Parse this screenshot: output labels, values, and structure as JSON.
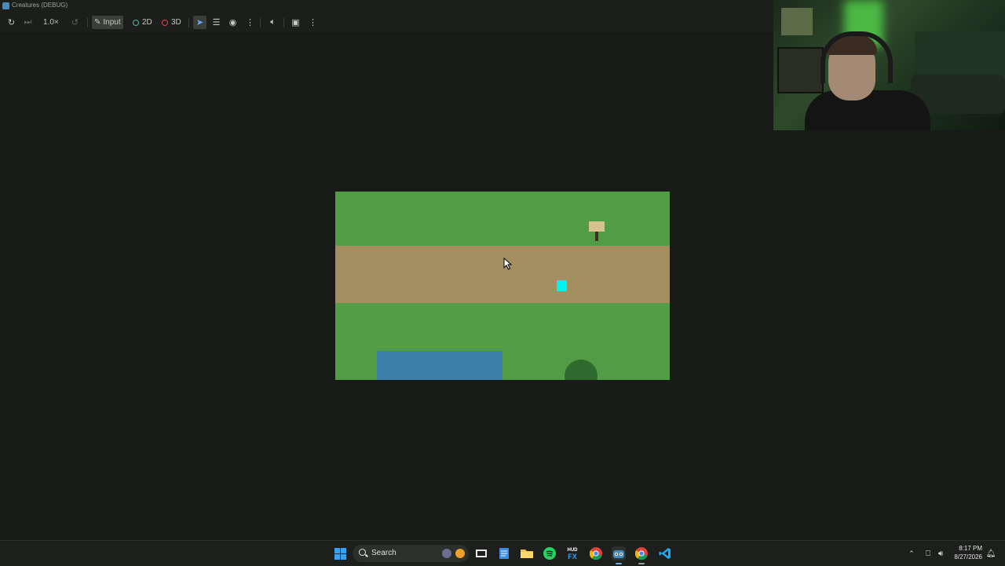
{
  "window": {
    "title": "Creatures (DEBUG)"
  },
  "toolbar": {
    "speed": "1.0×",
    "input_label": "Input",
    "mode_2d": "2D",
    "mode_3d": "3D",
    "colors": {
      "mode_2d": "#4fb8a6",
      "mode_3d": "#e0454a",
      "select": "#6aa6ff"
    }
  },
  "game": {
    "colors": {
      "grass": "#519c44",
      "path": "#a48f61",
      "water": "#3e7fa7",
      "bush": "#2e6a2d",
      "sign": "#d6c390",
      "player": "#00f4f4"
    }
  },
  "taskbar": {
    "search_label": "Search",
    "hud_label_top": "HUD",
    "hud_label_bottom": "FX",
    "time": "8:17 PM",
    "date": "8/27/2026"
  }
}
